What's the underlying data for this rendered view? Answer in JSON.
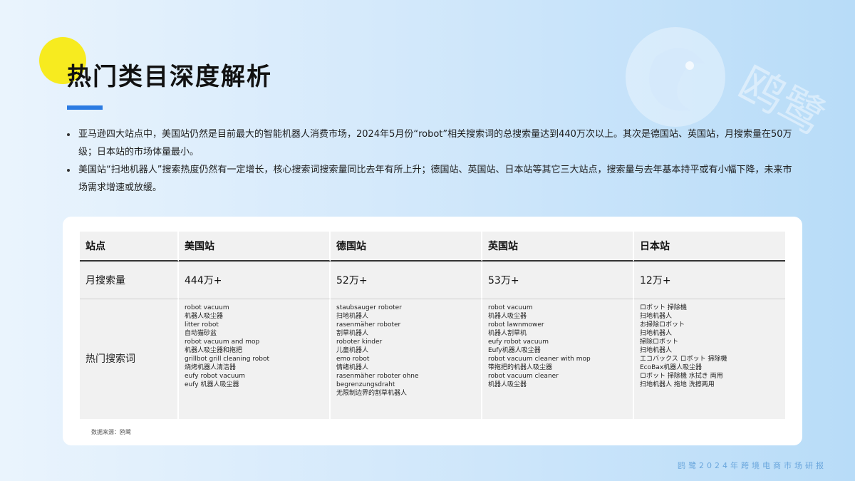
{
  "page": {
    "title": "热门类目深度解析",
    "watermark_text": "鸥鹭",
    "footer": "鸥鹭2024年跨境电商市场研报",
    "accent_color": "#2b7be2",
    "dot_color": "#f7eb1f"
  },
  "bullets": [
    "亚马逊四大站点中，美国站仍然是目前最大的智能机器人消费市场，2024年5月份“robot”相关搜索词的总搜索量达到440万次以上。其次是德国站、英国站，月搜索量在50万级；日本站的市场体量最小。",
    "美国站“扫地机器人”搜索热度仍然有一定增长，核心搜索词搜索量同比去年有所上升；德国站、英国站、日本站等其它三大站点，搜索量与去年基本持平或有小幅下降，未来市场需求增速或放缓。"
  ],
  "table": {
    "headers": [
      "站点",
      "美国站",
      "德国站",
      "英国站",
      "日本站"
    ],
    "volume_label": "月搜索量",
    "volumes": [
      "444万+",
      "52万+",
      "53万+",
      "12万+"
    ],
    "keywords_label": "热门搜索词",
    "keywords": [
      [
        "robot vacuum",
        "机器人吸尘器",
        "litter robot",
        "自动猫砂盆",
        "robot vacuum and mop",
        "机器人吸尘器和拖把",
        "grillbot grill cleaning robot",
        "烧烤机器人清洁器",
        "eufy robot vacuum",
        "eufy 机器人吸尘器"
      ],
      [
        "staubsauger roboter",
        "扫地机器人",
        "rasenmäher roboter",
        "割草机器人",
        "roboter kinder",
        "儿童机器人",
        "emo robot",
        "情绪机器人",
        "rasenmäher roboter ohne",
        "begrenzungsdraht",
        "无限制边界的割草机器人"
      ],
      [
        "robot vacuum",
        "机器人吸尘器",
        "robot lawnmower",
        "机器人割草机",
        "eufy robot vacuum",
        "Eufy机器人吸尘器",
        "robot vacuum cleaner with mop",
        "带拖把的机器人吸尘器",
        "robot vacuum cleaner",
        "机器人吸尘器"
      ],
      [
        "ロボット 掃除機",
        "扫地机器人",
        "お掃除ロボット",
        "扫地机器人",
        "掃除ロボット",
        "扫地机器人",
        "エコバックス ロボット 掃除機",
        "EcoBax机器人吸尘器",
        "ロボット 掃除機 水拭き 両用",
        "扫地机器人 拖地 洗擦两用"
      ]
    ],
    "source": "数据来源：鸥鹭"
  }
}
